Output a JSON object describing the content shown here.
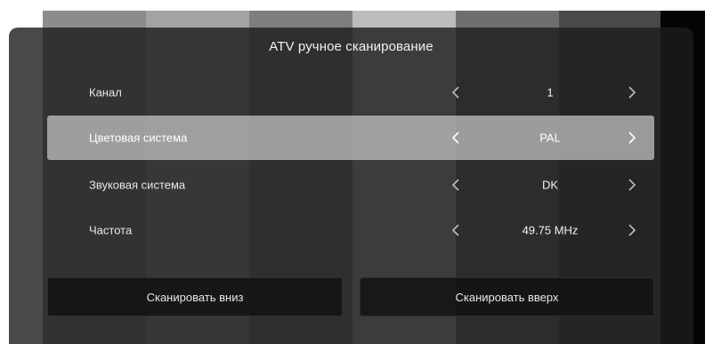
{
  "theme": {
    "stripe_colors": [
      "#8c8c8c",
      "#a3a3a3",
      "#7e7e7e",
      "#bcbcbc",
      "#6f6f6f",
      "#4a4a4a"
    ],
    "panel_color": "#1c1c1c",
    "selected_row_color": "#c8c8c8",
    "text_color": "#f2f2f2"
  },
  "dialog": {
    "title": "ATV ручное сканирование",
    "rows": [
      {
        "label": "Канал",
        "value": "1",
        "selected": false
      },
      {
        "label": "Цветовая система",
        "value": "PAL",
        "selected": true
      },
      {
        "label": "Звуковая система",
        "value": "DK",
        "selected": false
      },
      {
        "label": "Частота",
        "value": "49.75 MHz",
        "selected": false
      }
    ],
    "icons": {
      "prev": "chevron-left-icon",
      "next": "chevron-right-icon"
    }
  },
  "actions": {
    "scan_down_label": "Сканировать вниз",
    "scan_up_label": "Сканировать вверх"
  }
}
